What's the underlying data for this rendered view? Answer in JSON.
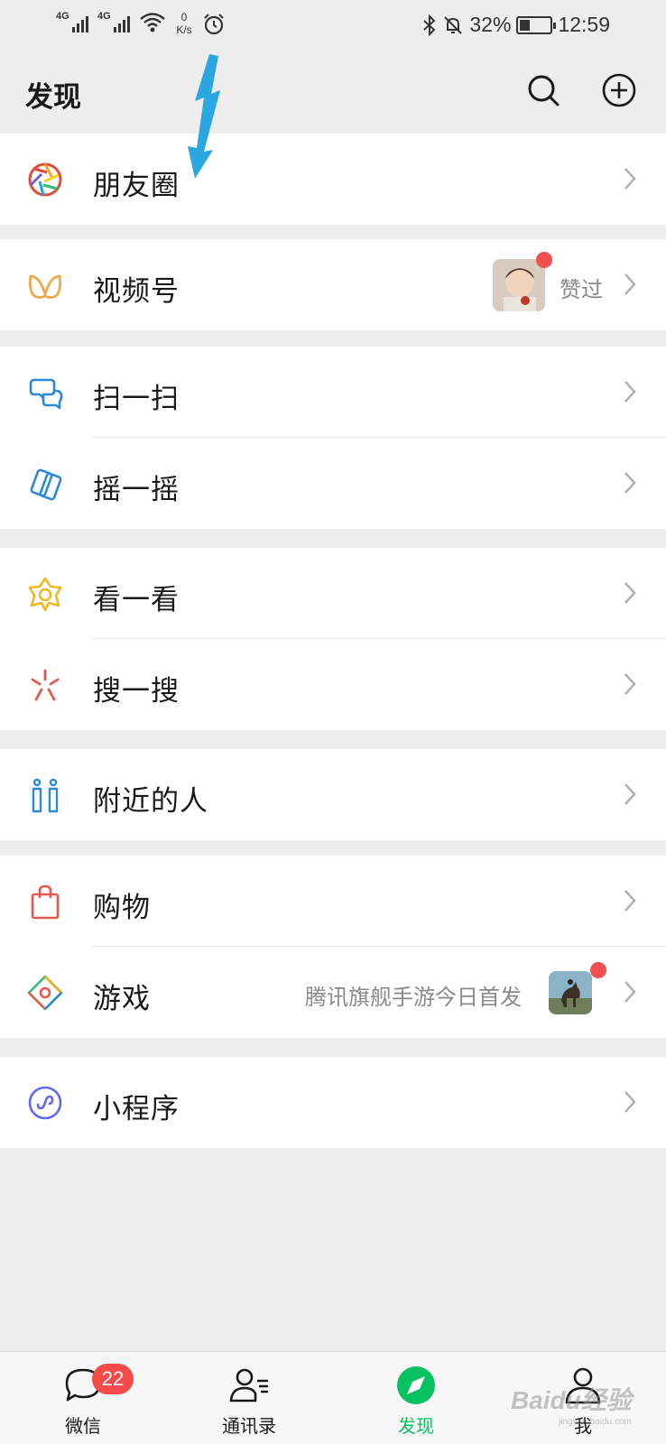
{
  "status_bar": {
    "net1": "4G",
    "net2": "4G",
    "speed_value": "0",
    "speed_unit": "K/s",
    "battery": "32%",
    "battery_level": 0.32,
    "time": "12:59"
  },
  "header": {
    "title": "发现",
    "search_icon": "search-icon",
    "add_icon": "plus-circle-icon"
  },
  "menu": {
    "moments": {
      "label": "朋友圈",
      "icon": "aperture-icon"
    },
    "channels": {
      "label": "视频号",
      "sub": "赞过",
      "icon": "butterfly-icon"
    },
    "scan": {
      "label": "扫一扫",
      "icon": "scan-icon"
    },
    "shake": {
      "label": "摇一摇",
      "icon": "shake-icon"
    },
    "top_stories": {
      "label": "看一看",
      "icon": "star-flower-icon"
    },
    "search": {
      "label": "搜一搜",
      "icon": "sparkle-icon"
    },
    "nearby": {
      "label": "附近的人",
      "icon": "people-icon"
    },
    "shopping": {
      "label": "购物",
      "icon": "shopping-bag-icon"
    },
    "games": {
      "label": "游戏",
      "sub": "腾讯旗舰手游今日首发",
      "icon": "diamond-icon"
    },
    "mini_programs": {
      "label": "小程序",
      "icon": "mini-program-icon"
    }
  },
  "tabbar": {
    "chats": {
      "label": "微信",
      "badge": "22"
    },
    "contacts": {
      "label": "通讯录"
    },
    "discover": {
      "label": "发现"
    },
    "me": {
      "label": "我"
    }
  },
  "colors": {
    "accent": "#07c160",
    "badge": "#f44a4a",
    "background": "#ededed",
    "arrow": "#2aa7e1"
  },
  "watermark": {
    "text": "Baidu经验",
    "sub": "jingyan.baidu.com"
  }
}
